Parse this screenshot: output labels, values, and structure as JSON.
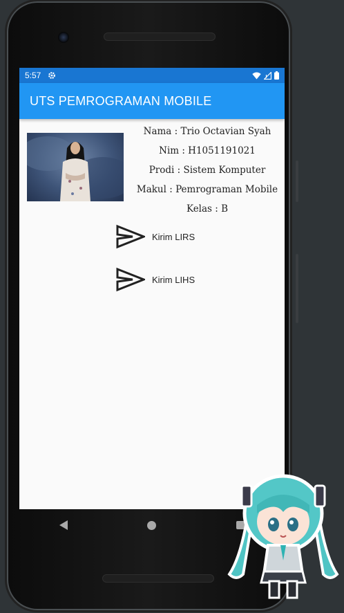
{
  "status_bar": {
    "time": "5:57"
  },
  "app_bar": {
    "title": "UTS PEMROGRAMAN MOBILE"
  },
  "profile": {
    "nama": "Nama : Trio Octavian Syah",
    "nim": "Nim : H1051191021",
    "prodi": "Prodi : Sistem Komputer",
    "makul": "Makul : Pemrograman Mobile",
    "kelas": "Kelas : B"
  },
  "actions": [
    {
      "label": "Kirim LIRS",
      "icon": "send-icon"
    },
    {
      "label": "Kirim LIHS",
      "icon": "send-icon"
    }
  ],
  "colors": {
    "status_bar": "#1976d2",
    "app_bar": "#2196f3",
    "screen_background": "#fafafa"
  }
}
